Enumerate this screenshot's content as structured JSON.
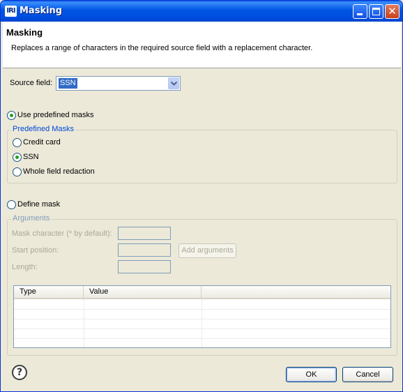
{
  "window": {
    "title": "Masking",
    "logo_text": "IRI",
    "title_buttons": {
      "minimize_icon": "minimize-icon",
      "maximize_icon": "maximize-icon",
      "close_icon": "close-icon",
      "close_glyph": "✕"
    }
  },
  "header": {
    "title": "Masking",
    "description": "Replaces a range of characters in the required source field with a replacement character."
  },
  "source_field": {
    "label": "Source field:",
    "value": "SSN"
  },
  "use_predefined": {
    "label": "Use predefined masks",
    "checked": true
  },
  "predefined_masks": {
    "title": "Predefined Masks",
    "options": [
      {
        "label": "Credit card",
        "checked": false
      },
      {
        "label": "SSN",
        "checked": true
      },
      {
        "label": "Whole field redaction",
        "checked": false
      }
    ]
  },
  "define_mask": {
    "label": "Define mask",
    "checked": false
  },
  "arguments": {
    "title": "Arguments",
    "mask_character_label": "Mask character (* by default):",
    "start_position_label": "Start position:",
    "length_label": "Length:",
    "mask_character_value": "",
    "start_position_value": "",
    "length_value": "",
    "add_button": "Add arguments"
  },
  "table": {
    "columns": [
      "Type",
      "Value"
    ],
    "rows": []
  },
  "footer": {
    "help_glyph": "?",
    "ok": "OK",
    "cancel": "Cancel"
  },
  "colors": {
    "titlebar": "#0054e3",
    "group_title": "#0046d5",
    "selection": "#316ac5",
    "radio_dot": "#21a121"
  }
}
